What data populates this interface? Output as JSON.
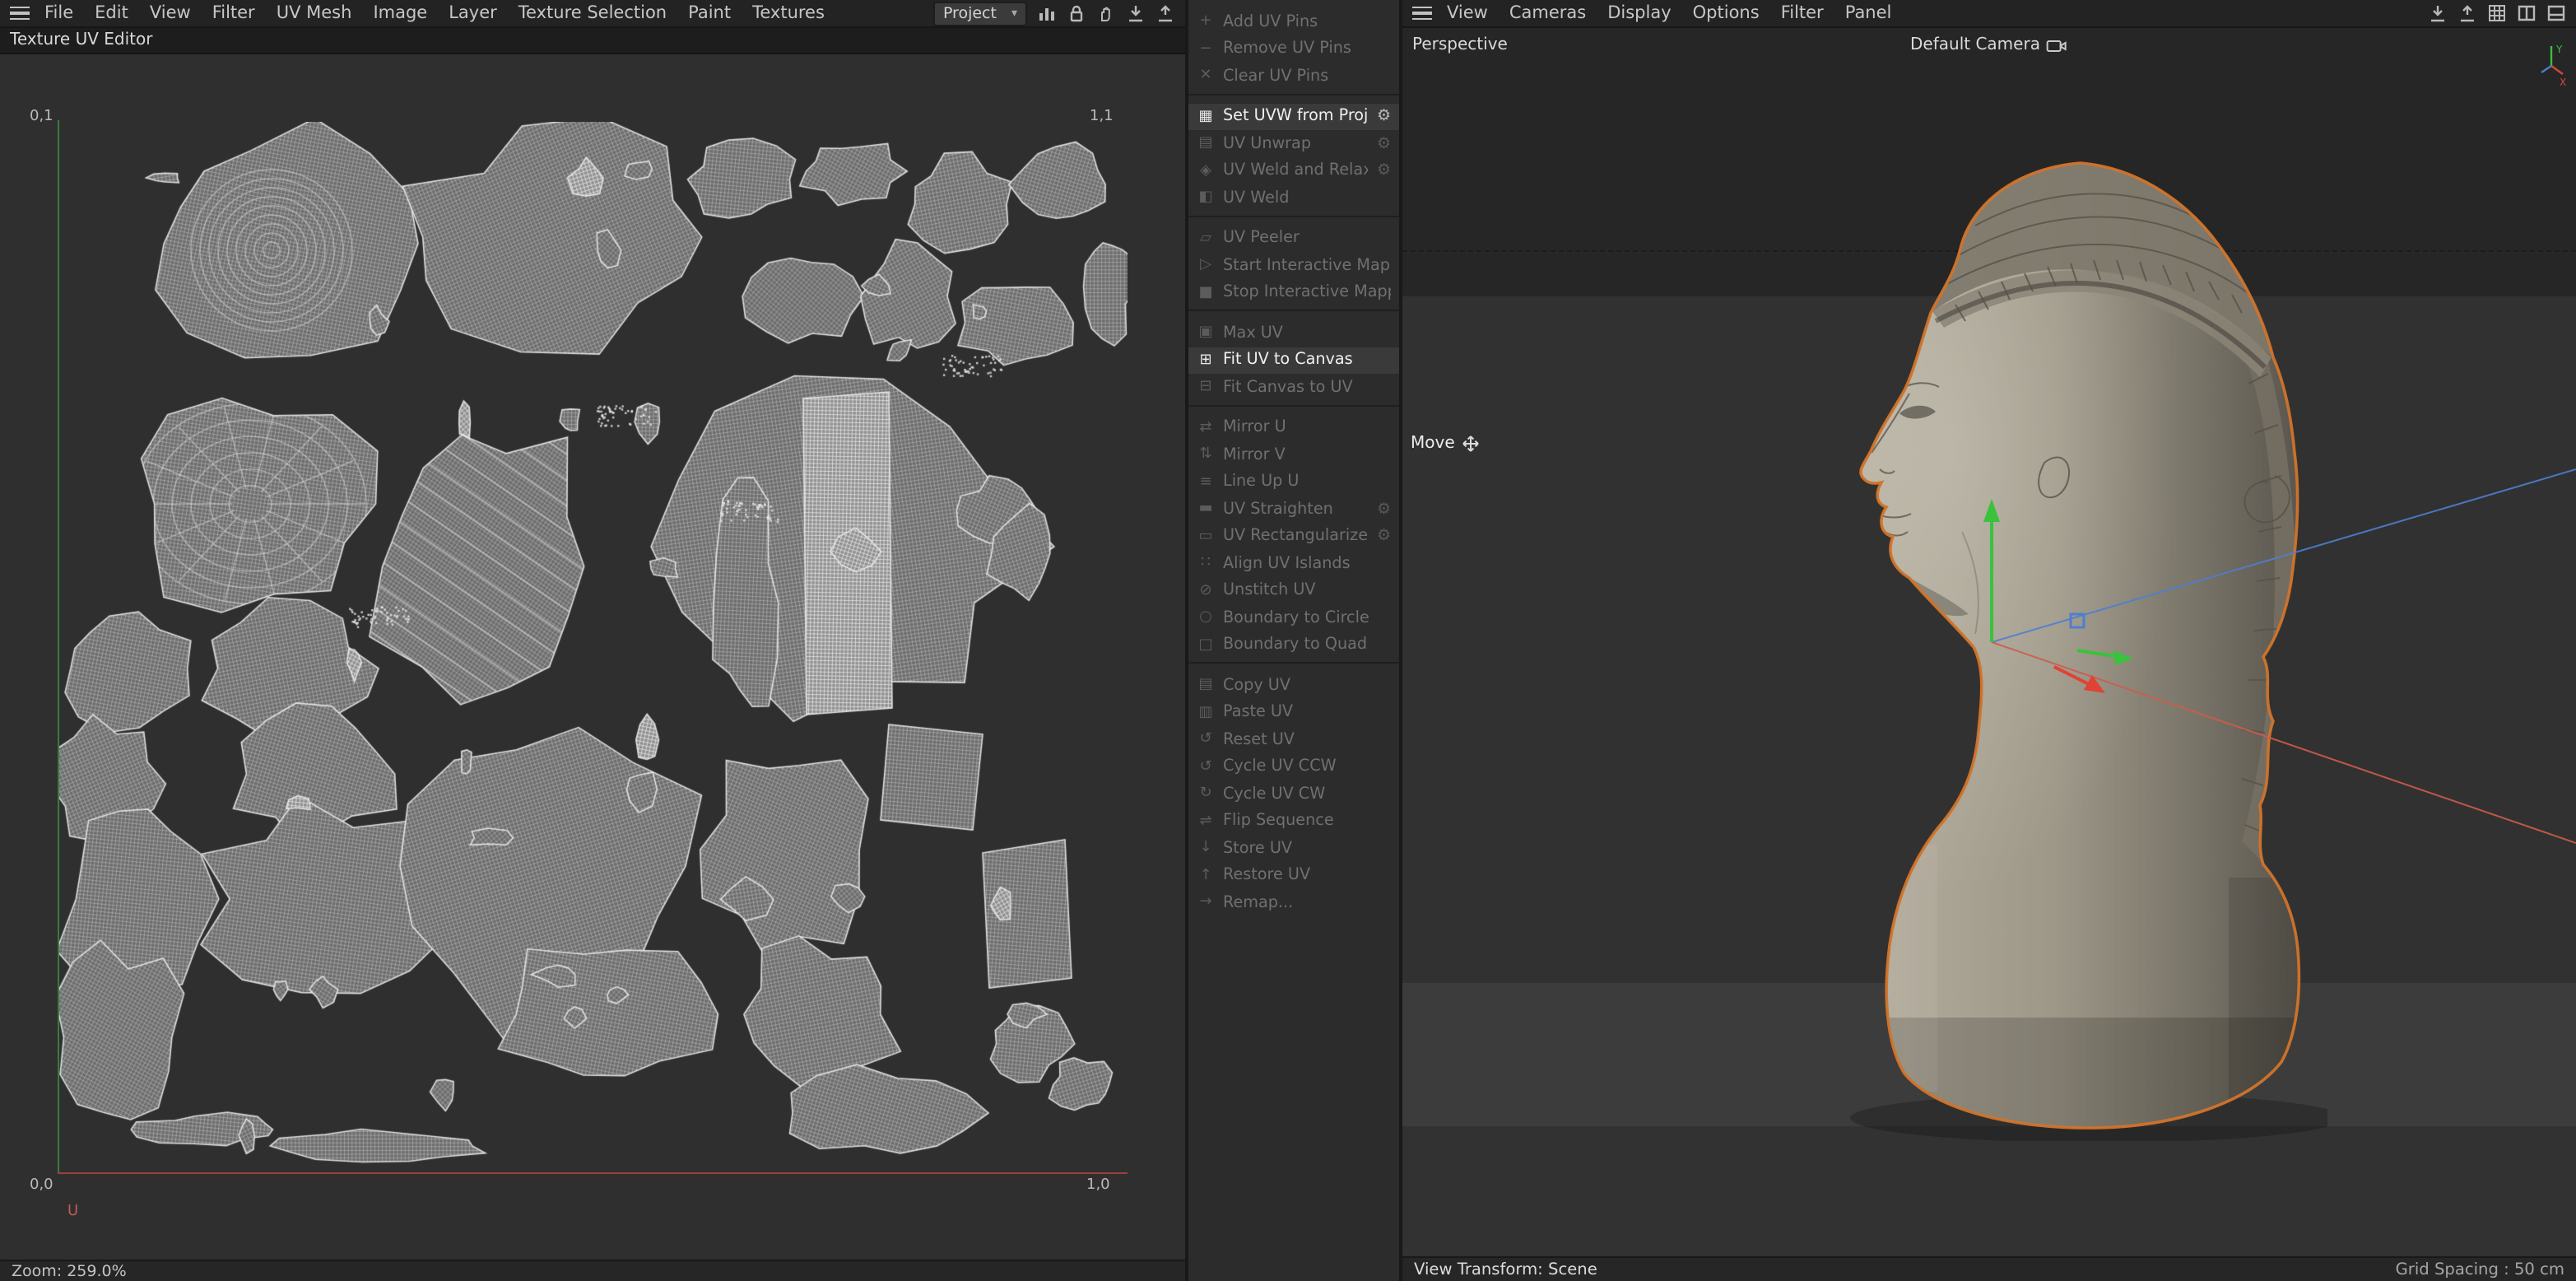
{
  "left": {
    "menubar": {
      "menus": [
        "File",
        "Edit",
        "View",
        "Filter",
        "UV Mesh",
        "Image",
        "Layer",
        "Texture Selection",
        "Paint",
        "Textures"
      ],
      "project_label": "Project"
    },
    "tab": "Texture UV Editor",
    "uv": {
      "corner_tl": "0,1",
      "corner_tr": "1,1",
      "corner_bl": "0,0",
      "corner_br": "1,0",
      "axis_u": "U"
    },
    "status_zoom": "Zoom: 259.0%"
  },
  "commands": {
    "items": [
      {
        "icon": "add-pin-icon",
        "glyph": "+",
        "label": "Add UV Pins",
        "enabled": false
      },
      {
        "icon": "remove-pin-icon",
        "glyph": "−",
        "label": "Remove UV Pins",
        "enabled": false
      },
      {
        "icon": "clear-pins-icon",
        "glyph": "✕",
        "label": "Clear UV Pins",
        "enabled": false
      },
      {
        "sep": true
      },
      {
        "icon": "projection-icon",
        "glyph": "▦",
        "label": "Set UVW from Projection",
        "enabled": true,
        "gear": true
      },
      {
        "icon": "unwrap-icon",
        "glyph": "▤",
        "label": "UV Unwrap",
        "enabled": false,
        "gear": true
      },
      {
        "icon": "weld-relax-icon",
        "glyph": "◈",
        "label": "UV Weld and Relax",
        "enabled": false,
        "gear": true
      },
      {
        "icon": "weld-icon",
        "glyph": "◧",
        "label": "UV Weld",
        "enabled": false
      },
      {
        "sep": true
      },
      {
        "icon": "peeler-icon",
        "glyph": "▱",
        "label": "UV Peeler",
        "enabled": false
      },
      {
        "icon": "start-mapping-icon",
        "glyph": "▷",
        "label": "Start Interactive Mapping",
        "enabled": false
      },
      {
        "icon": "stop-mapping-icon",
        "glyph": "■",
        "label": "Stop Interactive Mapping",
        "enabled": false
      },
      {
        "sep": true
      },
      {
        "icon": "max-uv-icon",
        "glyph": "▣",
        "label": "Max UV",
        "enabled": false
      },
      {
        "icon": "fit-uv-icon",
        "glyph": "⊞",
        "label": "Fit UV to Canvas",
        "enabled": true
      },
      {
        "icon": "fit-canvas-icon",
        "glyph": "⊟",
        "label": "Fit Canvas to UV",
        "enabled": false
      },
      {
        "sep": true
      },
      {
        "icon": "mirror-u-icon",
        "glyph": "⇄",
        "label": "Mirror U",
        "enabled": false
      },
      {
        "icon": "mirror-v-icon",
        "glyph": "⇅",
        "label": "Mirror V",
        "enabled": false
      },
      {
        "icon": "line-up-icon",
        "glyph": "≡",
        "label": "Line Up U",
        "enabled": false
      },
      {
        "icon": "straighten-icon",
        "glyph": "▬",
        "label": "UV Straighten",
        "enabled": false,
        "gear": true
      },
      {
        "icon": "rectangularize-icon",
        "glyph": "▭",
        "label": "UV Rectangularize",
        "enabled": false,
        "gear": true
      },
      {
        "icon": "align-islands-icon",
        "glyph": "∷",
        "label": "Align UV Islands",
        "enabled": false
      },
      {
        "icon": "unstitch-icon",
        "glyph": "⊘",
        "label": "Unstitch UV",
        "enabled": false
      },
      {
        "icon": "boundary-circle-icon",
        "glyph": "○",
        "label": "Boundary to Circle",
        "enabled": false
      },
      {
        "icon": "boundary-quad-icon",
        "glyph": "□",
        "label": "Boundary to Quad",
        "enabled": false
      },
      {
        "sep": true
      },
      {
        "icon": "copy-icon",
        "glyph": "▤",
        "label": "Copy UV",
        "enabled": false
      },
      {
        "icon": "paste-icon",
        "glyph": "▥",
        "label": "Paste UV",
        "enabled": false
      },
      {
        "icon": "reset-icon",
        "glyph": "↺",
        "label": "Reset UV",
        "enabled": false
      },
      {
        "icon": "cycle-ccw-icon",
        "glyph": "↺",
        "label": "Cycle UV CCW",
        "enabled": false
      },
      {
        "icon": "cycle-cw-icon",
        "glyph": "↻",
        "label": "Cycle UV CW",
        "enabled": false
      },
      {
        "icon": "flip-icon",
        "glyph": "⇌",
        "label": "Flip Sequence",
        "enabled": false
      },
      {
        "icon": "store-icon",
        "glyph": "↓",
        "label": "Store UV",
        "enabled": false
      },
      {
        "icon": "restore-icon",
        "glyph": "↑",
        "label": "Restore UV",
        "enabled": false
      },
      {
        "icon": "remap-icon",
        "glyph": "→",
        "label": "Remap...",
        "enabled": false
      }
    ]
  },
  "right": {
    "menubar": {
      "menus": [
        "View",
        "Cameras",
        "Display",
        "Options",
        "Filter",
        "Panel"
      ]
    },
    "viewport": {
      "projection": "Perspective",
      "camera": "Default Camera",
      "tool": "Move"
    },
    "status_left": "View Transform: Scene",
    "status_right": "Grid Spacing : 50 cm"
  },
  "colors": {
    "accent_orange": "#d2742a",
    "axis_green": "#39c23c",
    "axis_red": "#cf5c4c",
    "axis_blue": "#4d7fd0"
  }
}
